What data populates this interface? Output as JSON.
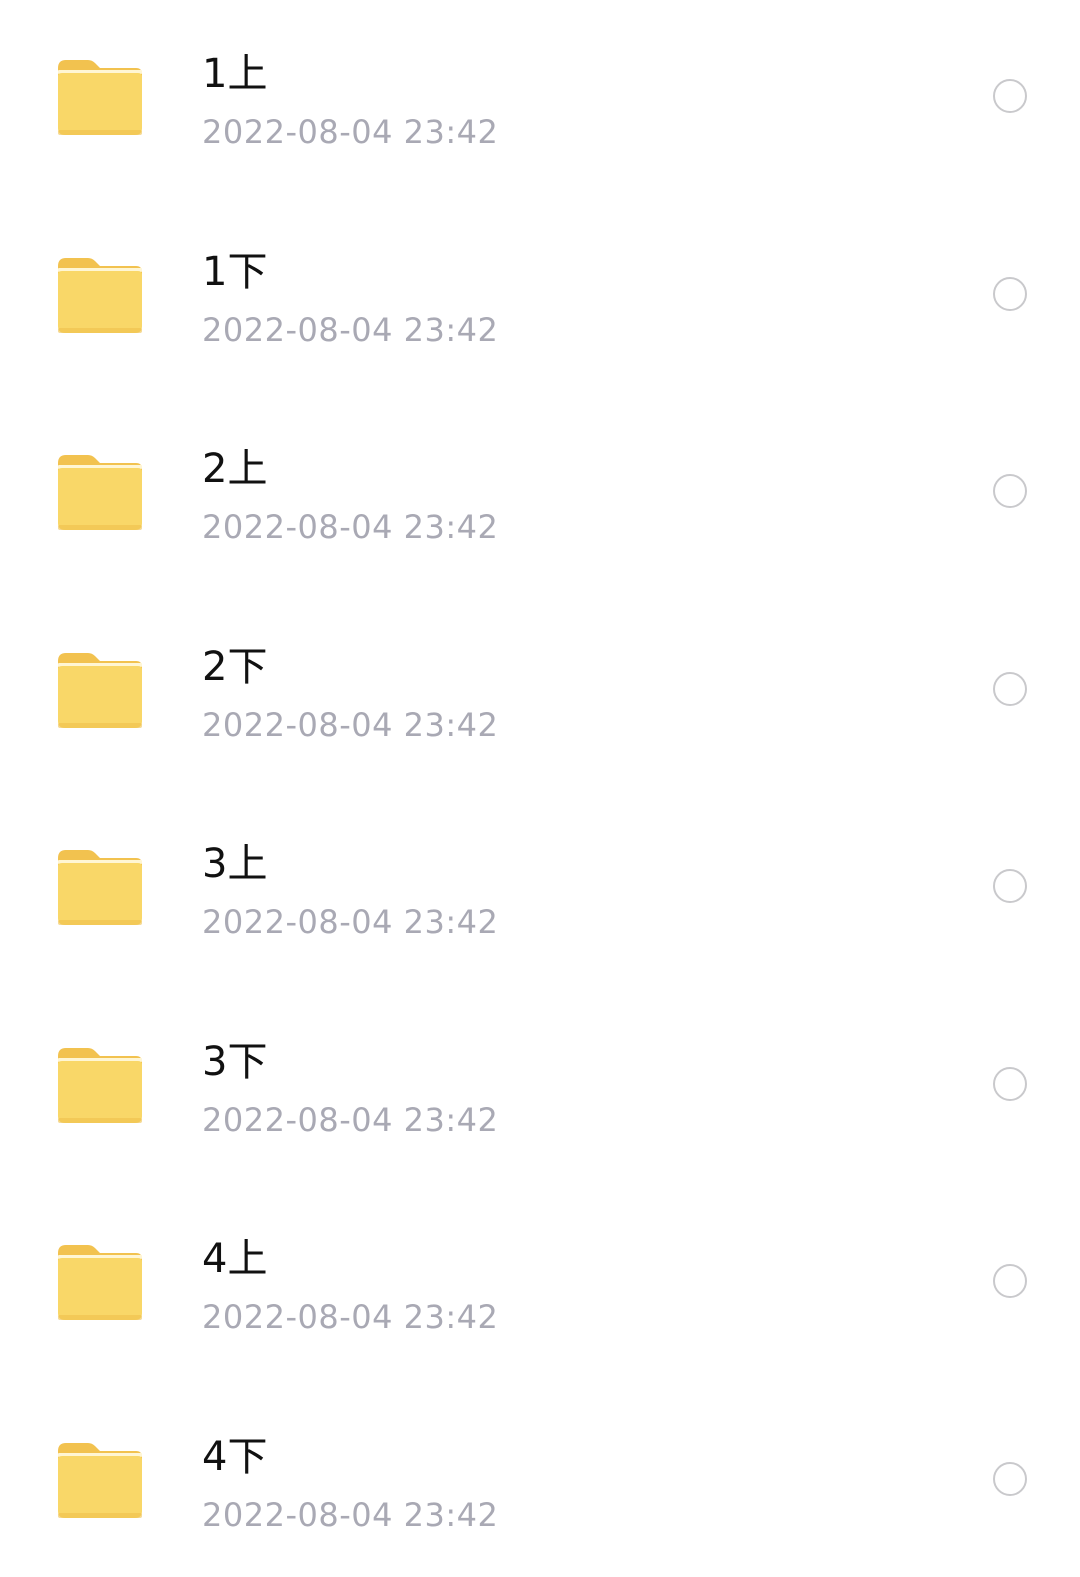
{
  "icon": "folder-icon",
  "colors": {
    "folder_body": "#f9d768",
    "folder_tab": "#f2c24f",
    "name_text": "#111111",
    "date_text": "#a9a9b4",
    "radio_border": "#c9c9cc"
  },
  "files": [
    {
      "name": "1上",
      "date": "2022-08-04 23:42",
      "selected": false
    },
    {
      "name": "1下",
      "date": "2022-08-04 23:42",
      "selected": false
    },
    {
      "name": "2上",
      "date": "2022-08-04 23:42",
      "selected": false
    },
    {
      "name": "2下",
      "date": "2022-08-04 23:42",
      "selected": false
    },
    {
      "name": "3上",
      "date": "2022-08-04 23:42",
      "selected": false
    },
    {
      "name": "3下",
      "date": "2022-08-04 23:42",
      "selected": false
    },
    {
      "name": "4上",
      "date": "2022-08-04 23:42",
      "selected": false
    },
    {
      "name": "4下",
      "date": "2022-08-04 23:42",
      "selected": false
    }
  ]
}
